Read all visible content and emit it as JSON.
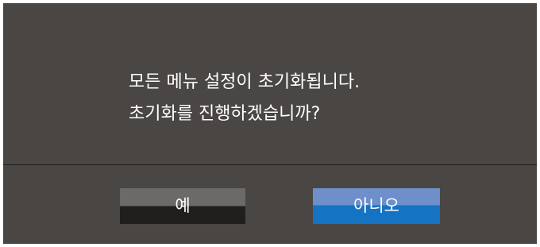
{
  "dialog": {
    "message_lines": [
      "모든 메뉴 설정이 초기화됩니다.",
      "초기화를 진행하겠습니까?"
    ],
    "buttons": {
      "yes_label": "예",
      "no_label": "아니오"
    }
  },
  "colors": {
    "dialog_background": "#4a4644",
    "divider": "#1e1c1b",
    "yes_button_top": "#6b6a69",
    "yes_button_bottom": "#201f1e",
    "no_button_top": "#6e8fca",
    "no_button_bottom": "#1473c3",
    "text": "#ffffff"
  }
}
